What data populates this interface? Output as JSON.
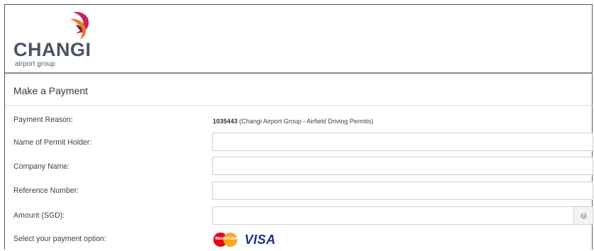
{
  "header": {
    "logo_word": "CHANGI",
    "logo_sub": "airport group"
  },
  "page": {
    "title": "Make a Payment"
  },
  "form": {
    "payment_reason": {
      "label": "Payment Reason:",
      "code": "1035443",
      "description": "(Changi Airport Group - Airfield Driving Permits)"
    },
    "permit_holder": {
      "label": "Name of Permit Holder:",
      "value": "",
      "placeholder": ""
    },
    "company_name": {
      "label": "Company Name:",
      "value": "",
      "placeholder": ""
    },
    "reference_number": {
      "label": "Reference Number:",
      "value": "",
      "placeholder": ""
    },
    "amount": {
      "label": "Amount (SGD):",
      "value": "",
      "placeholder": "",
      "help_icon": "question-circle-icon"
    },
    "payment_option": {
      "label": "Select your payment option:",
      "mastercard_text": "MasterCard",
      "visa_text": "VISA"
    }
  },
  "colors": {
    "logo_text": "#4a5360",
    "mastercard_red": "#e30613",
    "mastercard_orange": "#f9a21b",
    "visa_blue": "#1a2f8a",
    "field_border": "#cfcfcf"
  }
}
